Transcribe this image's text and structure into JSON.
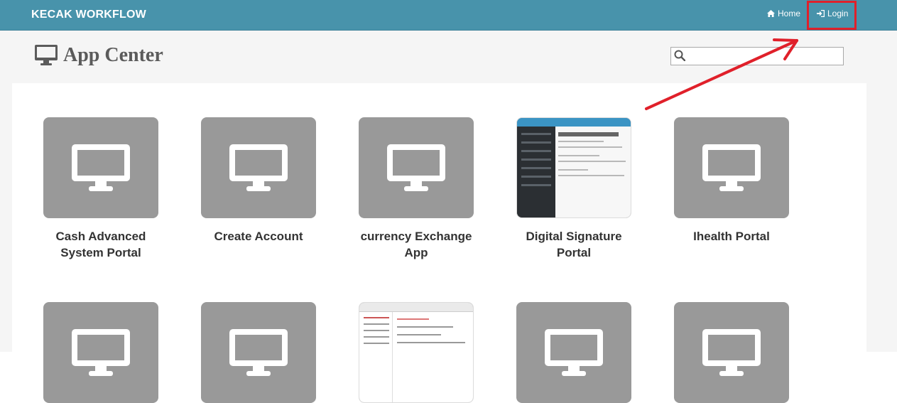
{
  "navbar": {
    "brand": "KECAK WORKFLOW",
    "home_label": "Home",
    "login_label": "Login"
  },
  "header": {
    "title": "App Center",
    "search_placeholder": ""
  },
  "apps": [
    {
      "name": "Cash Advanced System Portal",
      "thumb": "monitor-icon"
    },
    {
      "name": "Create Account",
      "thumb": "monitor-icon"
    },
    {
      "name": "currency Exchange App",
      "thumb": "monitor-icon"
    },
    {
      "name": "Digital Signature Portal",
      "thumb": "screenshot"
    },
    {
      "name": "Ihealth Portal",
      "thumb": "monitor-icon"
    },
    {
      "name": "",
      "thumb": "monitor-icon"
    },
    {
      "name": "",
      "thumb": "monitor-icon"
    },
    {
      "name": "",
      "thumb": "screenshot"
    },
    {
      "name": "",
      "thumb": "monitor-icon"
    },
    {
      "name": "",
      "thumb": "monitor-icon"
    }
  ],
  "colors": {
    "navbar": "#4893ab",
    "annotation": "#e0202a",
    "tile": "#999999"
  }
}
